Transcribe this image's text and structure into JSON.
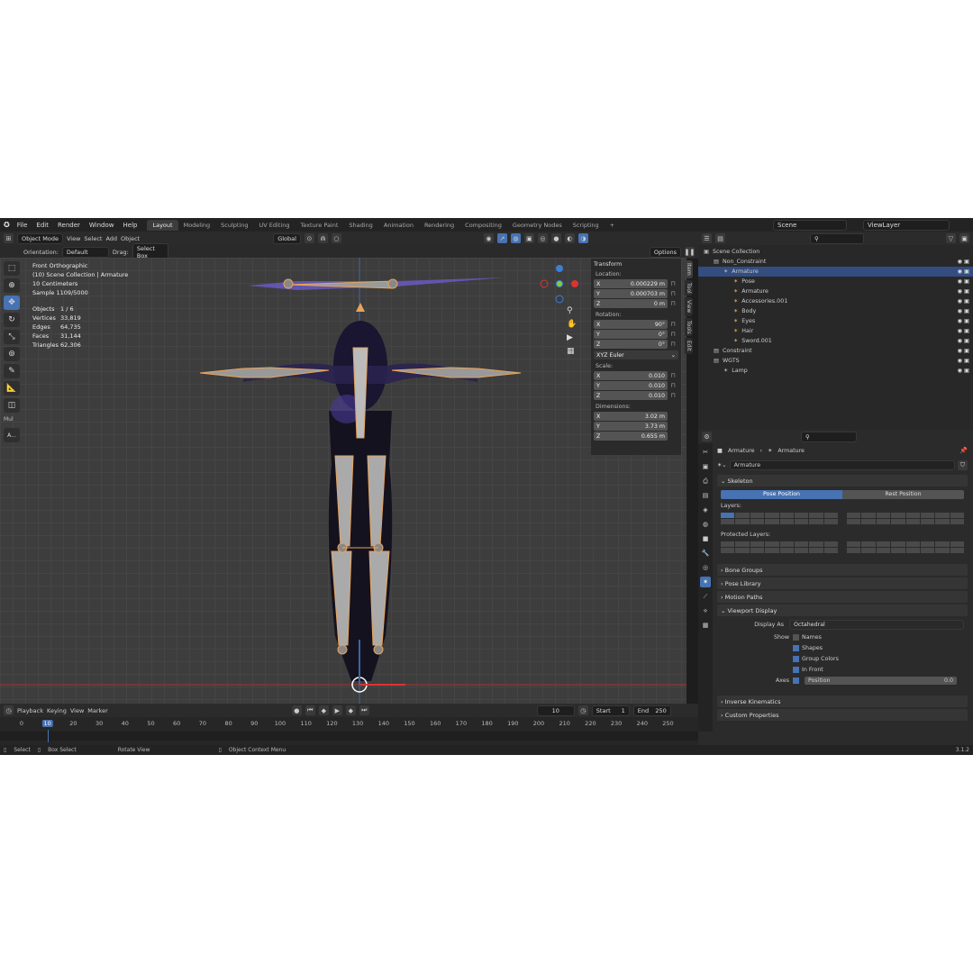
{
  "topbar": {
    "menus": [
      "File",
      "Edit",
      "Render",
      "Window",
      "Help"
    ],
    "tabs": [
      "Layout",
      "Modeling",
      "Sculpting",
      "UV Editing",
      "Texture Paint",
      "Shading",
      "Animation",
      "Rendering",
      "Compositing",
      "Geometry Nodes",
      "Scripting"
    ],
    "active_tab": "Layout",
    "add": "+",
    "scene": "Scene",
    "viewlayer": "ViewLayer"
  },
  "vp_header": {
    "mode": "Object Mode",
    "menus": [
      "View",
      "Select",
      "Add",
      "Object"
    ],
    "transform": "Global",
    "options": "Options"
  },
  "vp_header2": {
    "orientation_label": "Orientation:",
    "orientation": "Default",
    "drag_label": "Drag:",
    "drag": "Select Box"
  },
  "viewport_info": {
    "view": "Front Orthographic",
    "collection": "(10) Scene Collection | Armature",
    "scale": "10 Centimeters",
    "sample": "Sample 1109/5000",
    "stats": [
      [
        "Objects",
        "1 / 6"
      ],
      [
        "Vertices",
        "33,819"
      ],
      [
        "Edges",
        "64,735"
      ],
      [
        "Faces",
        "31,144"
      ],
      [
        "Triangles",
        "62,306"
      ]
    ]
  },
  "toolbar_extra": {
    "label": "Mul",
    "btn": "A..."
  },
  "npanel": {
    "title": "Transform",
    "location_label": "Location:",
    "location": [
      [
        "X",
        "0.000229 m"
      ],
      [
        "Y",
        "0.000703 m"
      ],
      [
        "Z",
        "0 m"
      ]
    ],
    "rotation_label": "Rotation:",
    "rotation": [
      [
        "X",
        "90°"
      ],
      [
        "Y",
        "0°"
      ],
      [
        "Z",
        "0°"
      ]
    ],
    "rot_mode": "XYZ Euler",
    "scale_label": "Scale:",
    "scale": [
      [
        "X",
        "0.010"
      ],
      [
        "Y",
        "0.010"
      ],
      [
        "Z",
        "0.010"
      ]
    ],
    "dim_label": "Dimensions:",
    "dimensions": [
      [
        "X",
        "3.02 m"
      ],
      [
        "Y",
        "3.73 m"
      ],
      [
        "Z",
        "0.655 m"
      ]
    ]
  },
  "sidetabs": [
    "Item",
    "Tool",
    "View",
    "Tools",
    "Edit"
  ],
  "timeline": {
    "menus": [
      "Playback",
      "Keying",
      "View",
      "Marker"
    ],
    "frame": "10",
    "start_label": "Start",
    "start": "1",
    "end_label": "End",
    "end": "250",
    "ticks": [
      "0",
      "10",
      "20",
      "30",
      "40",
      "50",
      "60",
      "70",
      "80",
      "90",
      "100",
      "110",
      "120",
      "130",
      "140",
      "150",
      "160",
      "170",
      "180",
      "190",
      "200",
      "210",
      "220",
      "230",
      "240",
      "250"
    ]
  },
  "statusbar": {
    "select": "Select",
    "box": "Box Select",
    "rotate": "Rotate View",
    "context": "Object Context Menu",
    "version": "3.1.2"
  },
  "outliner": {
    "items": [
      {
        "label": "Scene Collection",
        "indent": 0
      },
      {
        "label": "Non_Constraint",
        "indent": 1
      },
      {
        "label": "Armature",
        "indent": 2,
        "selected": true
      },
      {
        "label": "Pose",
        "indent": 3
      },
      {
        "label": "Armature",
        "indent": 3
      },
      {
        "label": "Accessories.001",
        "indent": 3
      },
      {
        "label": "Body",
        "indent": 3
      },
      {
        "label": "Eyes",
        "indent": 3
      },
      {
        "label": "Hair",
        "indent": 3
      },
      {
        "label": "Sword.001",
        "indent": 3
      },
      {
        "label": "Constraint",
        "indent": 1
      },
      {
        "label": "WGTS",
        "indent": 1
      },
      {
        "label": "Lamp",
        "indent": 2
      }
    ]
  },
  "props": {
    "breadcrumb1": "Armature",
    "breadcrumb2": "Armature",
    "name": "Armature",
    "skeleton": "Skeleton",
    "pose_position": "Pose Position",
    "rest_position": "Rest Position",
    "layers": "Layers:",
    "protected": "Protected Layers:",
    "bone_groups": "Bone Groups",
    "pose_library": "Pose Library",
    "motion_paths": "Motion Paths",
    "viewport_display": "Viewport Display",
    "display_as_label": "Display As",
    "display_as": "Octahedral",
    "show_label": "Show",
    "names": "Names",
    "shapes": "Shapes",
    "group_colors": "Group Colors",
    "in_front": "In Front",
    "axes_label": "Axes",
    "position_label": "Position",
    "position_val": "0.0",
    "ik": "Inverse Kinematics",
    "custom": "Custom Properties"
  }
}
